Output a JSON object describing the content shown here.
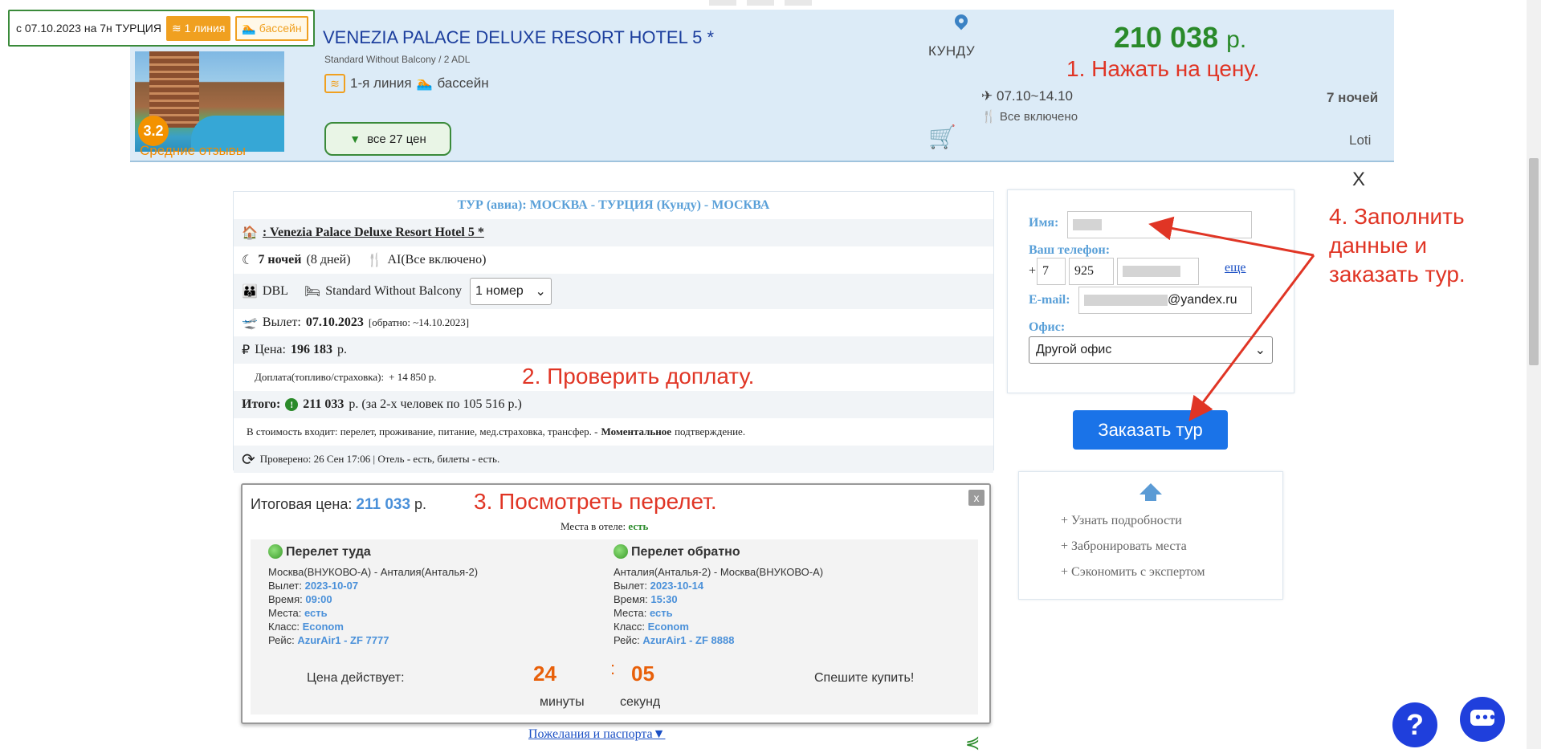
{
  "tooltip": {
    "text": "с 07.10.2023 на 7н ТУРЦИЯ",
    "chip_line": "1 линия",
    "chip_pool": "бассейн"
  },
  "hotel": {
    "title": "VENEZIA PALACE DELUXE RESORT HOTEL 5 *",
    "room": "Standard Without Balcony / 2 ADL",
    "line": "1-я линия",
    "pool": "бассейн",
    "rating": "3.2",
    "reviews": "Средние отзывы",
    "prices_button": "все 27 цен",
    "city": "КУНДУ",
    "price": "210 038",
    "currency": "р.",
    "dates": "07.10~14.10",
    "meal": "Все включено",
    "nights": "7 ночей",
    "operator": "Loti"
  },
  "annotations": {
    "a1": "1. Нажать на цену.",
    "a2": "2. Проверить доплату.",
    "a3": "3. Посмотреть перелет.",
    "a4_1": "4. Заполнить",
    "a4_2": "данные и",
    "a4_3": "заказать тур."
  },
  "close_label": "X",
  "tour": {
    "header": "ТУР (авиа): МОСКВА - ТУРЦИЯ (Кунду) - МОСКВА",
    "hotel_link": ": Venezia Palace Deluxe Resort Hotel 5 *",
    "nights": "7 ночей",
    "days": "(8 дней)",
    "meal": "AI(Все включено)",
    "accommodation": "DBL",
    "room_type": "Standard Without Balcony",
    "room_count": "1 номер",
    "departure_label": "Вылет:",
    "departure_date": "07.10.2023",
    "return_info": "[обратно: ~14.10.2023]",
    "price_label": "Цена:",
    "price_value": "196 183",
    "currency": "р.",
    "surcharge_label": "Доплата(топливо/страховка):",
    "surcharge_value": "+ 14 850 р.",
    "total_label": "Итого:",
    "total_value": "211 033",
    "total_note": "р. (за 2-х человек по 105 516 р.)",
    "includes_text": "В стоимость входит: перелет, проживание, питание, мед.страховка, трансфер. -",
    "includes_bold": "Моментальное",
    "includes_tail": "подтверждение.",
    "checked": "Проверено: 26 Сен 17:06 | Отель - есть, билеты - есть."
  },
  "form": {
    "name_label": "Имя:",
    "phone_label": "Ваш телефон:",
    "phone_plus": "+",
    "phone_code": "7",
    "phone_area": "925",
    "more_link": "еще",
    "email_label": "E-mail:",
    "email_domain": "@yandex.ru",
    "office_label": "Офис:",
    "office_value": "Другой офис",
    "submit": "Заказать тур"
  },
  "info_box": {
    "item1": "+ Узнать подробности",
    "item2": "+ Забронировать места",
    "item3": "+ Сэкономить с экспертом"
  },
  "flight": {
    "total_label": "Итоговая цена:",
    "total_value": "211 033",
    "currency": "р.",
    "seats_label": "Места в отеле:",
    "seats_value": "есть",
    "close": "x",
    "there": {
      "title": "Перелет туда",
      "route": "Москва(ВНУКОВО-А) - Анталия(Анталья-2)",
      "dep_label": "Вылет:",
      "dep_value": "2023-10-07",
      "time_label": "Время:",
      "time_value": "09:00",
      "seats_label": "Места:",
      "seats_value": "есть",
      "class_label": "Класс:",
      "class_value": "Econom",
      "flight_label": "Рейс:",
      "flight_value": "AzurAir1 - ZF 7777"
    },
    "back": {
      "title": "Перелет обратно",
      "route": "Анталия(Анталья-2) - Москва(ВНУКОВО-А)",
      "dep_label": "Вылет:",
      "dep_value": "2023-10-14",
      "time_label": "Время:",
      "time_value": "15:30",
      "seats_label": "Места:",
      "seats_value": "есть",
      "class_label": "Класс:",
      "class_value": "Econom",
      "flight_label": "Рейс:",
      "flight_value": "AzurAir1 - ZF 8888"
    },
    "valid_label": "Цена действует:",
    "minutes": "24",
    "minutes_label": "минуты",
    "separator": ":",
    "seconds": "05",
    "seconds_label": "секунд",
    "hurry": "Спешите купить!"
  },
  "wishes_link": "Пожелания и паспорта▼",
  "help_label": "?",
  "icons": [
    "hotel-photo",
    "waves-icon",
    "swim-icon",
    "map-pin-icon",
    "cart-icon",
    "plane-icon",
    "fork-knife-icon",
    "home-icon",
    "moon-icon",
    "family-icon",
    "bed-icon",
    "ruble-icon",
    "refresh-icon",
    "globe-icon",
    "arrow-up-icon",
    "share-icon",
    "chat-icon",
    "help-icon"
  ],
  "colors": {
    "accent": "#1a73e8",
    "price_green": "#2a8a2a",
    "annotation_red": "#e03525",
    "label_blue": "#5aa0d8",
    "banner_bg": "#dcebf7",
    "orange": "#f0a020"
  }
}
